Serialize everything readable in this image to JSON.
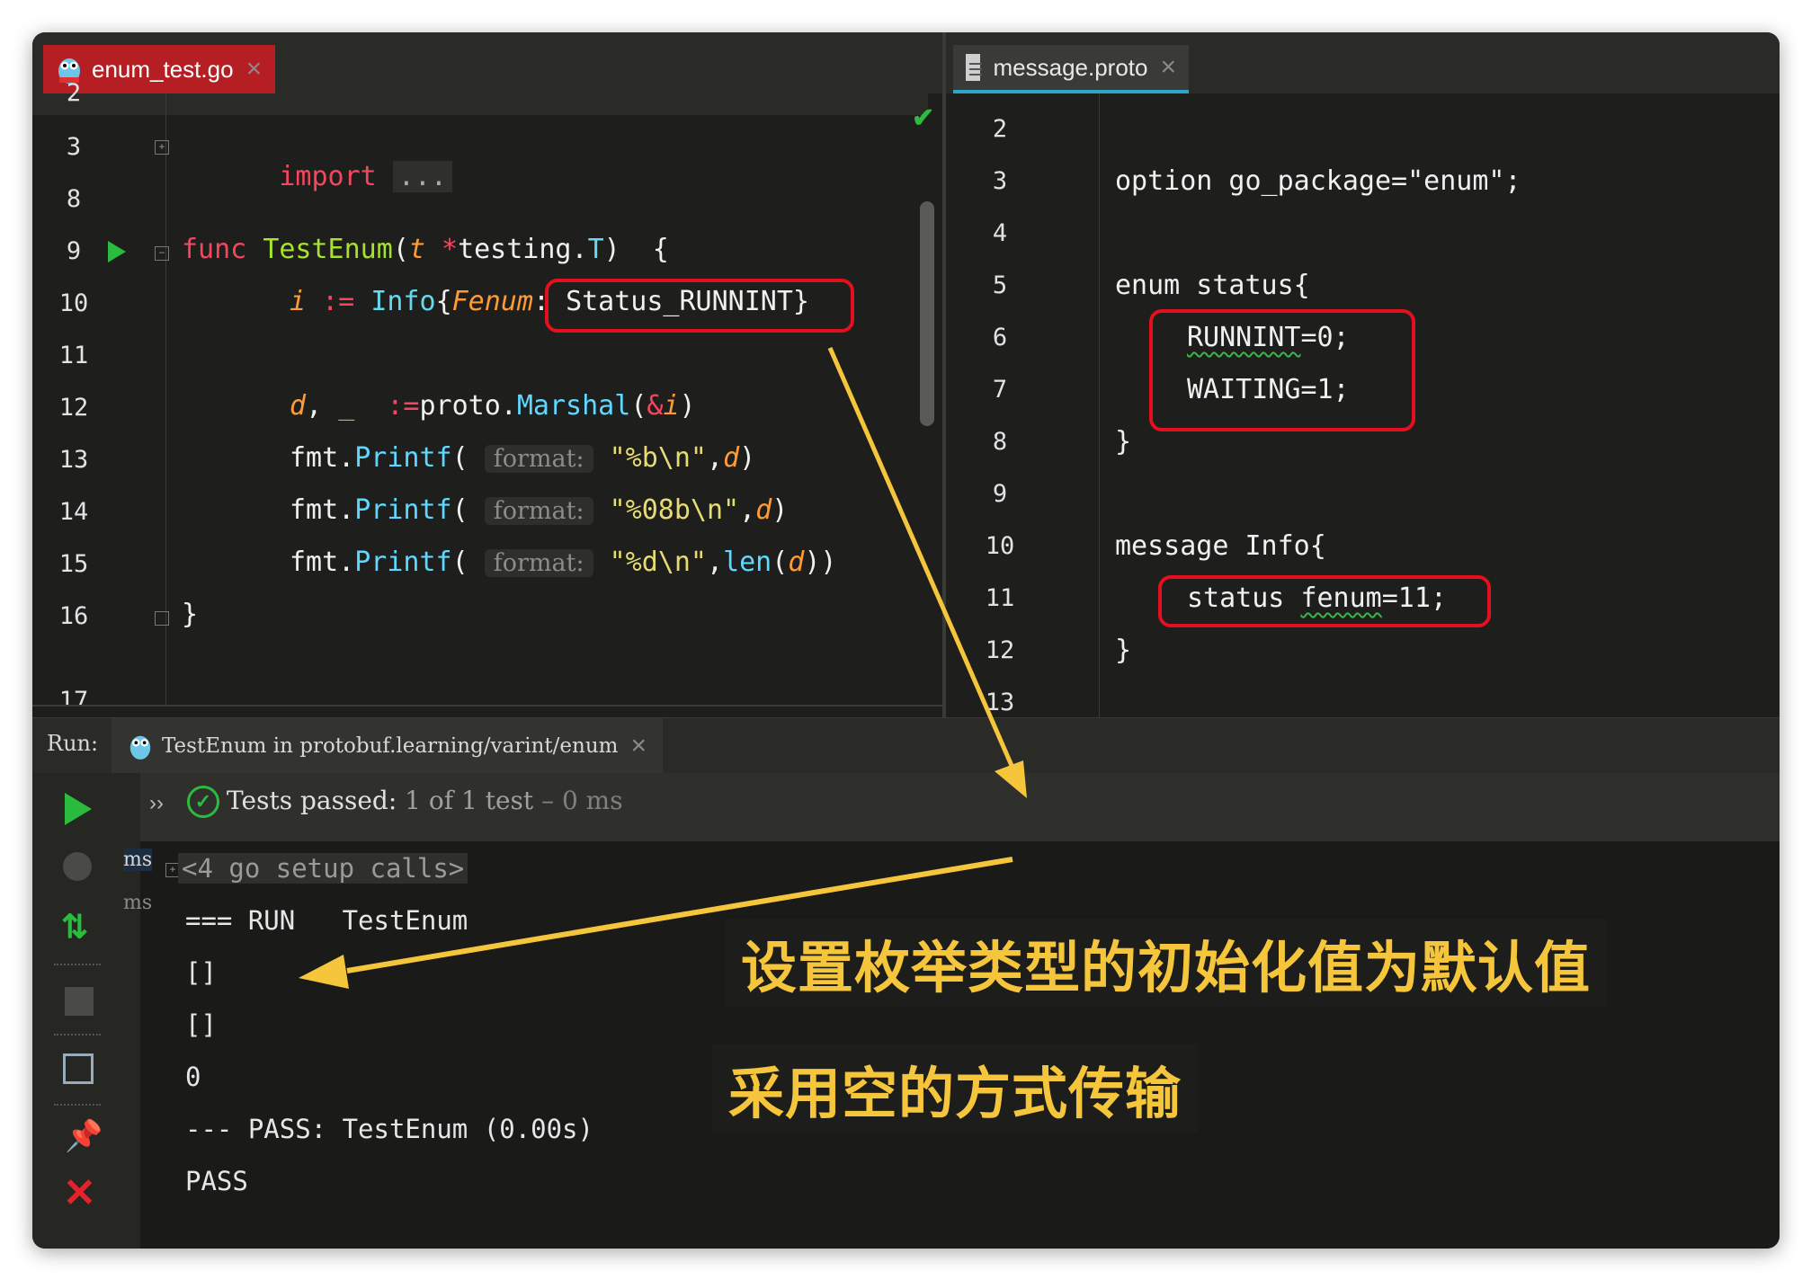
{
  "left_editor": {
    "tab_label": "enum_test.go",
    "lines": [
      {
        "num": "2"
      },
      {
        "num": "3"
      },
      {
        "num": "8"
      },
      {
        "num": "9"
      },
      {
        "num": "10"
      },
      {
        "num": "11"
      },
      {
        "num": "12"
      },
      {
        "num": "13"
      },
      {
        "num": "14"
      },
      {
        "num": "15"
      },
      {
        "num": "16"
      },
      {
        "num": "17"
      }
    ],
    "code": {
      "l3_kw": "import",
      "l3_fold": "...",
      "l9_kw": "func",
      "l9_fn": "TestEnum",
      "l9_open": "(",
      "l9_param": "t",
      "l9_star": " *",
      "l9_pkg": "testing.",
      "l9_type": "T",
      "l9_close": ")  {",
      "l10_var": "i",
      "l10_op": " := ",
      "l10_type": "Info",
      "l10_brace": "{",
      "l10_field": "Fenum",
      "l10_colon": ": ",
      "l10_value": "Status_RUNNINT}",
      "l12_var": "d",
      "l12_comma": ", ",
      "l12_blank": "_",
      "l12_op": "  :=",
      "l12_pkg": "proto.",
      "l12_fn": "Marshal",
      "l12_paren": "(",
      "l12_amp": "&",
      "l12_arg": "i",
      "l12_close": ")",
      "l13_pkg": "fmt.",
      "l13_fn": "Printf",
      "l13_paren": "( ",
      "l13_hint": "format:",
      "l13_str": "\"%b\\n\"",
      "l13_comma": ",",
      "l13_arg": "d",
      "l13_close": ")",
      "l14_pkg": "fmt.",
      "l14_fn": "Printf",
      "l14_paren": "( ",
      "l14_hint": "format:",
      "l14_str": "\"%08b\\n\"",
      "l14_comma": ",",
      "l14_arg": "d",
      "l14_close": ")",
      "l15_pkg": "fmt.",
      "l15_fn": "Printf",
      "l15_paren": "( ",
      "l15_hint": "format:",
      "l15_str": "\"%d\\n\"",
      "l15_comma": ",",
      "l15_len": "len",
      "l15_paren2": "(",
      "l15_arg": "d",
      "l15_close": "))",
      "l16_brace": "}"
    }
  },
  "right_editor": {
    "tab_label": "message.proto",
    "lines": [
      {
        "num": "2"
      },
      {
        "num": "3"
      },
      {
        "num": "4"
      },
      {
        "num": "5"
      },
      {
        "num": "6"
      },
      {
        "num": "7"
      },
      {
        "num": "8"
      },
      {
        "num": "9"
      },
      {
        "num": "10"
      },
      {
        "num": "11"
      },
      {
        "num": "12"
      },
      {
        "num": "13"
      }
    ],
    "code": {
      "l3": "option go_package=\"enum\";",
      "l5": "enum status{",
      "l6_name": "RUNNINT",
      "l6_rest": "=0;",
      "l7": "WAITING=1;",
      "l8": "}",
      "l10": "message Info{",
      "l11_type": "status ",
      "l11_name": "fenum",
      "l11_rest": "=11;",
      "l12": "}"
    }
  },
  "run_panel": {
    "label": "Run:",
    "tab_label": "TestEnum in protobuf.learning/varint/enum",
    "status_prefix": "Tests passed:",
    "status_count": "1 of 1 test",
    "status_time": "– 0 ms",
    "side_times": [
      "ms",
      "ms"
    ],
    "output": {
      "setup": "<4 go setup calls>",
      "run": "=== RUN   TestEnum",
      "o1": "[]",
      "o2": "[]",
      "o3": "0",
      "pass_line": "--- PASS: TestEnum (0.00s)",
      "pass": "PASS"
    }
  },
  "annotations": {
    "caption_1": "设置枚举类型的初始化值为默认值",
    "caption_2": "采用空的方式传输"
  },
  "colors": {
    "highlight_box": "#e4101d",
    "arrow": "#f5c53b",
    "caption_text": "#f5c53b",
    "run_green": "#2bbb3f",
    "stop_red": "#e4222b"
  }
}
